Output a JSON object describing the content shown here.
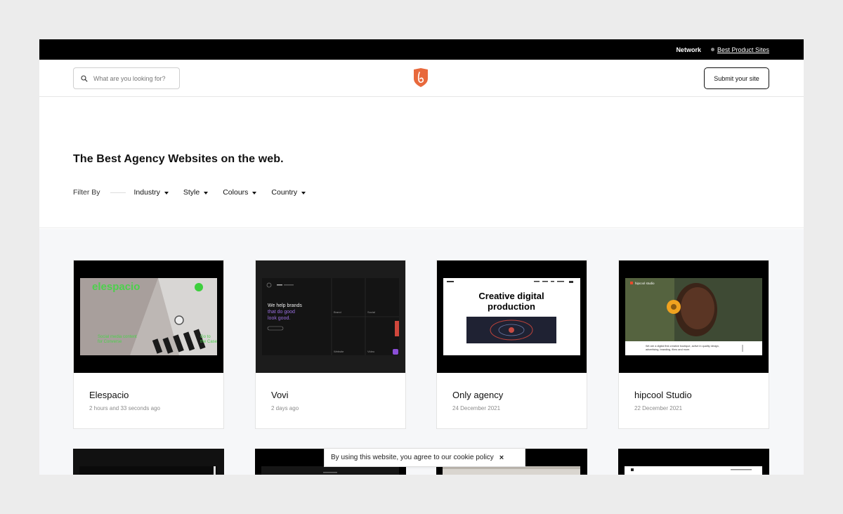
{
  "topbar": {
    "network_label": "Network",
    "link_label": "Best Product Sites"
  },
  "header": {
    "search_placeholder": "What are you looking for?",
    "submit_label": "Submit your site",
    "brand_color": "#e8693c"
  },
  "hero": {
    "title": "The Best Agency Websites on the web.",
    "filter_label": "Filter By",
    "filters": [
      "Industry",
      "Style",
      "Colours",
      "Country"
    ]
  },
  "cards": [
    {
      "title": "Elespacio",
      "date": "2 hours and 33 seconds ago",
      "thumb_text": [
        "elespacio",
        "Social media content",
        "for Converse",
        "Go to",
        "the Case"
      ]
    },
    {
      "title": "Vovi",
      "date": "2 days ago",
      "thumb_text": [
        "We help brands",
        "that do good",
        "look good.",
        "Brand",
        "Social",
        "Website",
        "Video"
      ]
    },
    {
      "title": "Only agency",
      "date": "24 December 2021",
      "thumb_text": [
        "Creative digital",
        "production"
      ]
    },
    {
      "title": "hipcool Studio",
      "date": "22 December 2021",
      "thumb_text": [
        "hipcool studio",
        "We are a digital first creative boutique, active in quality design,",
        "advertising, branding, films and more."
      ]
    }
  ],
  "cookie": {
    "text": "By using this website, you agree to our cookie policy",
    "close": "×"
  }
}
